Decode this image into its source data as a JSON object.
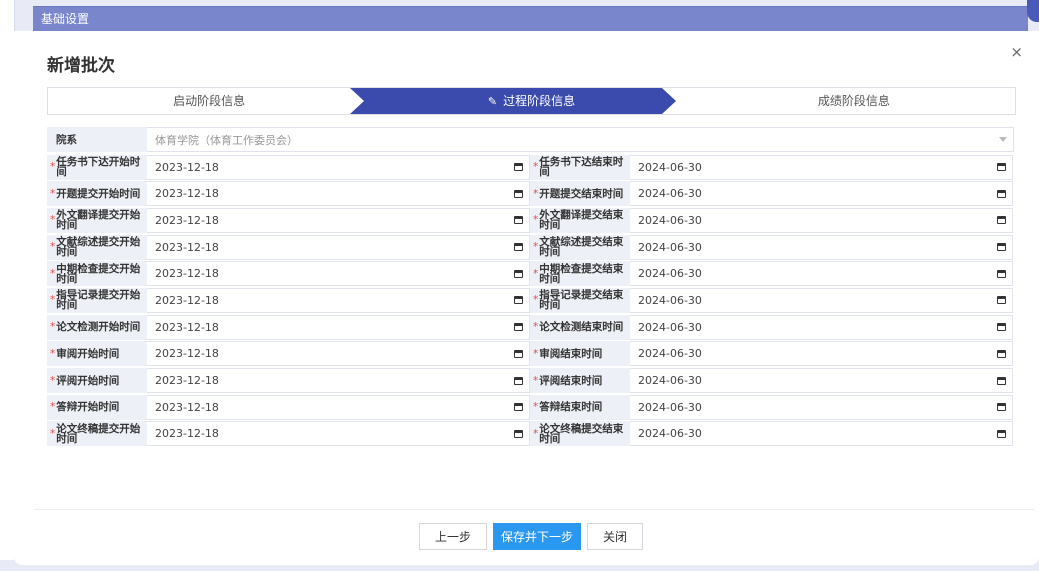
{
  "header": {
    "section_title": "基础设置"
  },
  "dialog": {
    "title": "新增批次",
    "close_icon": "×"
  },
  "steps": [
    {
      "label": "启动阶段信息",
      "active": false
    },
    {
      "label": "过程阶段信息",
      "active": true,
      "icon": "pencil-icon"
    },
    {
      "label": "成绩阶段信息",
      "active": false
    }
  ],
  "department": {
    "label": "院系",
    "value": "体育学院（体育工作委员会）"
  },
  "rows": [
    {
      "l1": "任务书下达开始时间",
      "v1": "2023-12-18",
      "l2": "任务书下达结束时间",
      "v2": "2024-06-30"
    },
    {
      "l1": "开题提交开始时间",
      "v1": "2023-12-18",
      "l2": "开题提交结束时间",
      "v2": "2024-06-30"
    },
    {
      "l1": "外文翻译提交开始时间",
      "v1": "2023-12-18",
      "l2": "外文翻译提交结束时间",
      "v2": "2024-06-30"
    },
    {
      "l1": "文献综述提交开始时间",
      "v1": "2023-12-18",
      "l2": "文献综述提交结束时间",
      "v2": "2024-06-30"
    },
    {
      "l1": "中期检查提交开始时间",
      "v1": "2023-12-18",
      "l2": "中期检查提交结束时间",
      "v2": "2024-06-30"
    },
    {
      "l1": "指导记录提交开始时间",
      "v1": "2023-12-18",
      "l2": "指导记录提交结束时间",
      "v2": "2024-06-30"
    },
    {
      "l1": "论文检测开始时间",
      "v1": "2023-12-18",
      "l2": "论文检测结束时间",
      "v2": "2024-06-30"
    },
    {
      "l1": "审阅开始时间",
      "v1": "2023-12-18",
      "l2": "审阅结束时间",
      "v2": "2024-06-30"
    },
    {
      "l1": "评阅开始时间",
      "v1": "2023-12-18",
      "l2": "评阅结束时间",
      "v2": "2024-06-30"
    },
    {
      "l1": "答辩开始时间",
      "v1": "2023-12-18",
      "l2": "答辩结束时间",
      "v2": "2024-06-30"
    },
    {
      "l1": "论文终稿提交开始时间",
      "v1": "2023-12-18",
      "l2": "论文终稿提交结束时间",
      "v2": "2024-06-30"
    }
  ],
  "buttons": {
    "prev": "上一步",
    "save_next": "保存并下一步",
    "close": "关闭"
  },
  "colors": {
    "accent": "#3b4bad",
    "primary_button": "#2a98f0",
    "required": "#e34b4b"
  }
}
